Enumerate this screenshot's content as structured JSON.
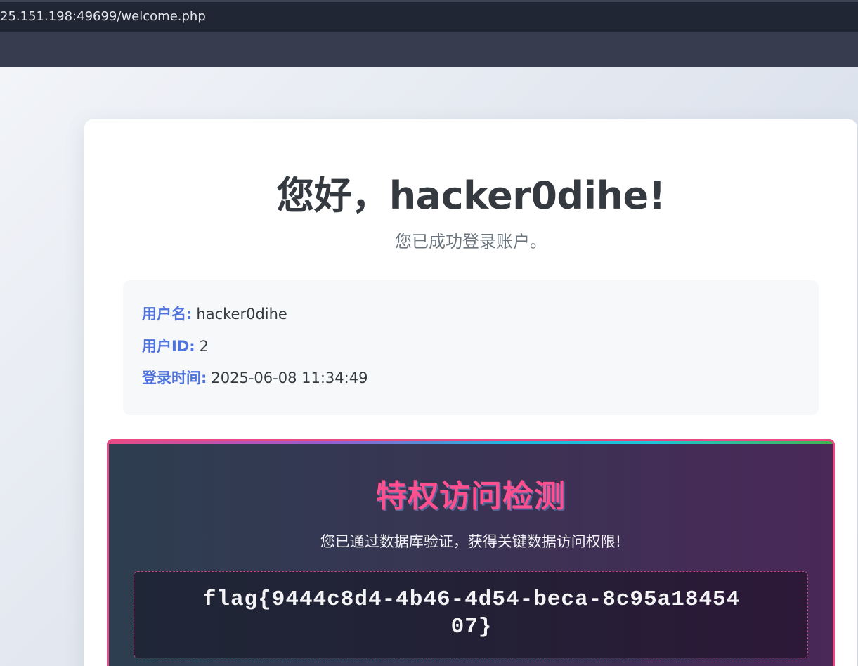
{
  "browser": {
    "url": "25.151.198:49699/welcome.php"
  },
  "welcome": {
    "title": "您好，hacker0dihe!",
    "subtitle": "您已成功登录账户。"
  },
  "user_info": {
    "username_label": "用户名:",
    "username_value": "hacker0dihe",
    "userid_label": "用户ID:",
    "userid_value": "2",
    "login_time_label": "登录时间:",
    "login_time_value": "2025-06-08 11:34:49"
  },
  "privilege": {
    "title": "特权访问检测",
    "description": "您已通过数据库验证，获得关键数据访问权限!",
    "flag": "flag{9444c8d4-4b46-4d54-beca-8c95a1845407}"
  },
  "colors": {
    "accent_blue": "#4f72dc",
    "flag_pink": "#ff4f8e"
  }
}
